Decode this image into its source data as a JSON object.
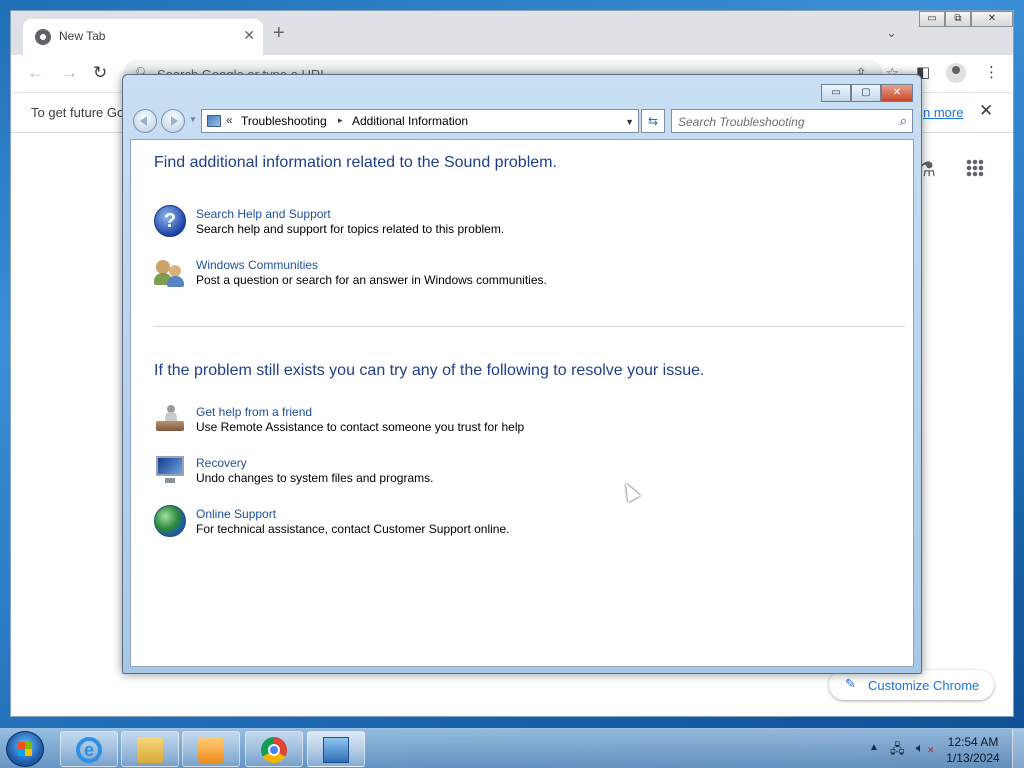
{
  "chrome": {
    "tab_title": "New Tab",
    "tab_close": "✕",
    "new_tab": "+",
    "tab_search": "⌄",
    "win_min": "▭",
    "win_max": "⧉",
    "win_close": "✕",
    "omnibox_placeholder": "Search Google or type a URL",
    "infobar_text": "To get future Go",
    "infobar_link": "n more",
    "infobar_close": "✕",
    "customize_label": "Customize Chrome"
  },
  "dialog": {
    "controls": {
      "min": "▭",
      "max": "▢",
      "close": "✕"
    },
    "address": {
      "chevron": "«",
      "crumbs": [
        "Troubleshooting",
        "Additional Information"
      ],
      "separator": "▸",
      "dropdown": "▼"
    },
    "refresh": "⇆",
    "search_placeholder": "Search Troubleshooting",
    "heading1": "Find additional information related to the Sound problem.",
    "heading2": "If the problem still exists you can try any of the following to resolve your issue.",
    "section1": [
      {
        "title": "Search Help and Support",
        "desc": "Search help and support for topics related to this problem.",
        "icon": "help-icon"
      },
      {
        "title": "Windows Communities",
        "desc": "Post a question or search for an answer in Windows communities.",
        "icon": "community-icon"
      }
    ],
    "section2": [
      {
        "title": "Get help from a friend",
        "desc": "Use Remote Assistance to contact someone you trust for help",
        "icon": "remote-assistance-icon"
      },
      {
        "title": "Recovery",
        "desc": "Undo changes to system files and programs.",
        "icon": "recovery-icon"
      },
      {
        "title": "Online Support",
        "desc": "For technical assistance, contact Customer Support online.",
        "icon": "globe-icon"
      }
    ]
  },
  "taskbar": {
    "items": [
      "internet-explorer",
      "windows-explorer",
      "windows-media-player",
      "google-chrome",
      "control-panel"
    ],
    "clock_time": "12:54 AM",
    "clock_date": "1/13/2024"
  }
}
